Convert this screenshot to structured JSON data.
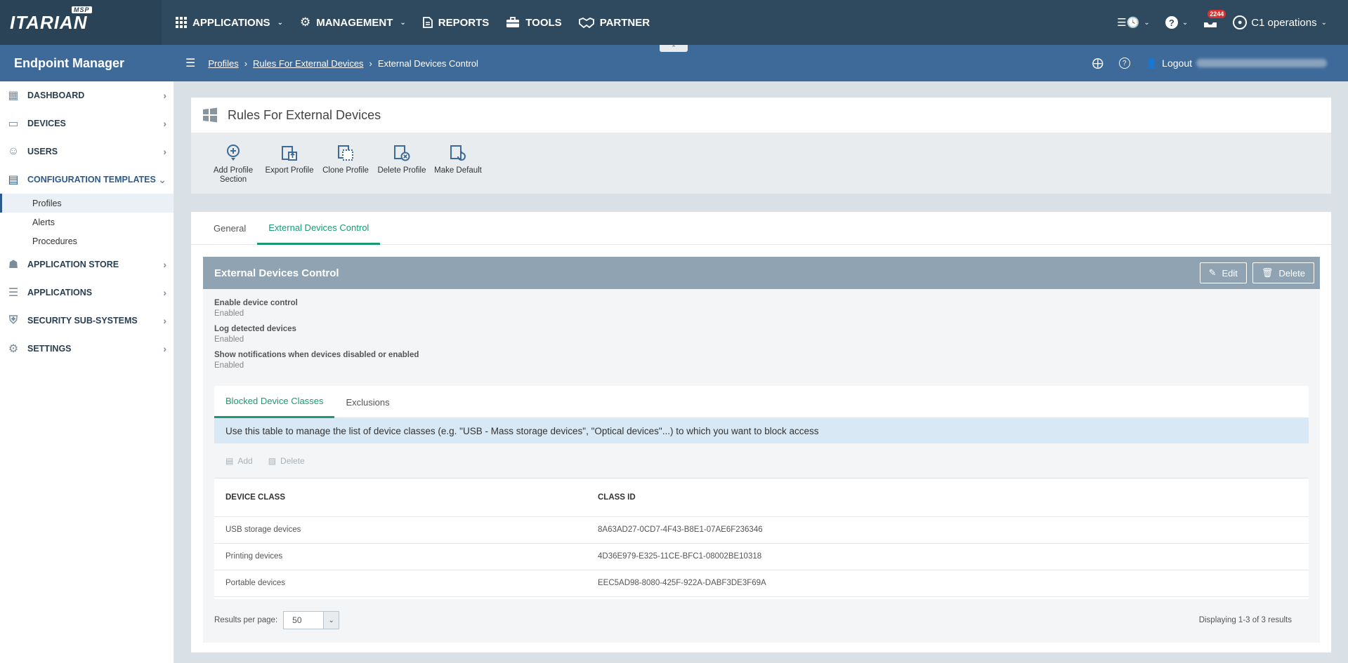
{
  "brand": {
    "logo": "ITARIAN",
    "msp": "MSP"
  },
  "topnav": [
    {
      "label": "APPLICATIONS",
      "icon": "grid-icon",
      "caret": true
    },
    {
      "label": "MANAGEMENT",
      "icon": "gear-icon",
      "caret": true
    },
    {
      "label": "REPORTS",
      "icon": "document-icon",
      "caret": false
    },
    {
      "label": "TOOLS",
      "icon": "toolbox-icon",
      "caret": false
    },
    {
      "label": "PARTNER",
      "icon": "handshake-icon",
      "caret": false
    }
  ],
  "topright": {
    "notifications": "2244",
    "user": "C1 operations"
  },
  "subbar": {
    "title": "Endpoint Manager",
    "breadcrumb": [
      "Profiles",
      "Rules For External Devices",
      "External Devices Control"
    ],
    "logout": "Logout"
  },
  "sidebar": {
    "items": [
      {
        "label": "DASHBOARD"
      },
      {
        "label": "DEVICES"
      },
      {
        "label": "USERS"
      },
      {
        "label": "CONFIGURATION TEMPLATES"
      },
      {
        "label": "APPLICATION STORE"
      },
      {
        "label": "APPLICATIONS"
      },
      {
        "label": "SECURITY SUB-SYSTEMS"
      },
      {
        "label": "SETTINGS"
      }
    ],
    "subitems": [
      "Profiles",
      "Alerts",
      "Procedures"
    ]
  },
  "page": {
    "title": "Rules For External Devices",
    "toolbar": [
      "Add Profile Section",
      "Export Profile",
      "Clone Profile",
      "Delete Profile",
      "Make Default"
    ],
    "tabs": [
      "General",
      "External Devices Control"
    ],
    "section": {
      "title": "External Devices Control",
      "edit": "Edit",
      "delete": "Delete",
      "props": [
        {
          "label": "Enable device control",
          "value": "Enabled"
        },
        {
          "label": "Log detected devices",
          "value": "Enabled"
        },
        {
          "label": "Show notifications when devices disabled or enabled",
          "value": "Enabled"
        }
      ],
      "inner_tabs": [
        "Blocked Device Classes",
        "Exclusions"
      ],
      "info": "Use this table to manage the list of device classes (e.g. \"USB - Mass storage devices\", \"Optical devices\"...) to which you want to block access",
      "table_tools": {
        "add": "Add",
        "delete": "Delete"
      },
      "columns": [
        "DEVICE CLASS",
        "CLASS ID"
      ],
      "rows": [
        [
          "USB storage devices",
          "8A63AD27-0CD7-4F43-B8E1-07AE6F236346"
        ],
        [
          "Printing devices",
          "4D36E979-E325-11CE-BFC1-08002BE10318"
        ],
        [
          "Portable devices",
          "EEC5AD98-8080-425F-922A-DABF3DE3F69A"
        ]
      ],
      "results_label": "Results per page:",
      "results_value": "50",
      "displaying": "Displaying 1-3 of 3 results"
    }
  }
}
